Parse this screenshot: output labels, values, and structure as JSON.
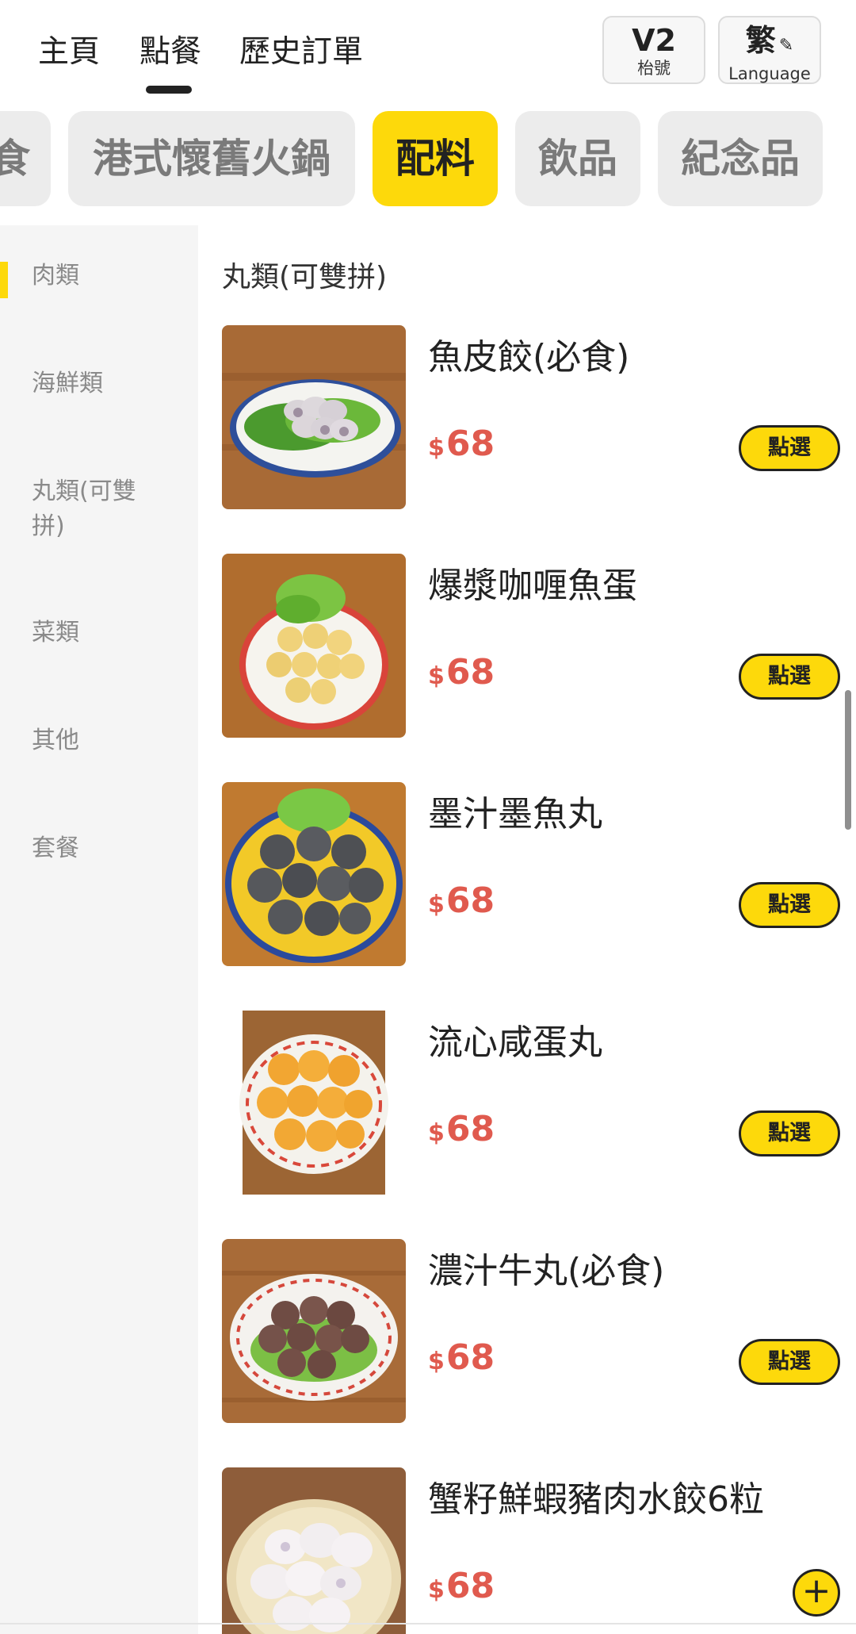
{
  "nav": {
    "tabs": [
      "主頁",
      "點餐",
      "歷史訂單"
    ],
    "active_tab": "點餐"
  },
  "table_button": {
    "value": "V2",
    "label": "枱號"
  },
  "language_button": {
    "value": "繁",
    "label": "Language",
    "icon": "pencil-icon"
  },
  "categories": [
    "食",
    "港式懷舊火鍋",
    "配料",
    "飲品",
    "紀念品"
  ],
  "active_category": "配料",
  "sidebar": {
    "items": [
      "肉類",
      "海鮮類",
      "丸類(可雙拼)",
      "菜類",
      "其他",
      "套餐"
    ],
    "active": "肉類"
  },
  "section_title": "丸類(可雙拼)",
  "items": [
    {
      "name": "魚皮餃(必食)",
      "currency": "$",
      "price": "68",
      "button": "點選"
    },
    {
      "name": "爆漿咖喱魚蛋",
      "currency": "$",
      "price": "68",
      "button": "點選"
    },
    {
      "name": "墨汁墨魚丸",
      "currency": "$",
      "price": "68",
      "button": "點選"
    },
    {
      "name": "流心咸蛋丸",
      "currency": "$",
      "price": "68",
      "button": "點選"
    },
    {
      "name": "濃汁牛丸(必食)",
      "currency": "$",
      "price": "68",
      "button": "點選"
    },
    {
      "name": "蟹籽鮮蝦豬肉水餃6粒",
      "currency": "$",
      "price": "68",
      "button": "+"
    }
  ],
  "colors": {
    "accent": "#fdd90b",
    "price": "#e05a4e",
    "sidebar_bg": "#f5f5f5"
  }
}
